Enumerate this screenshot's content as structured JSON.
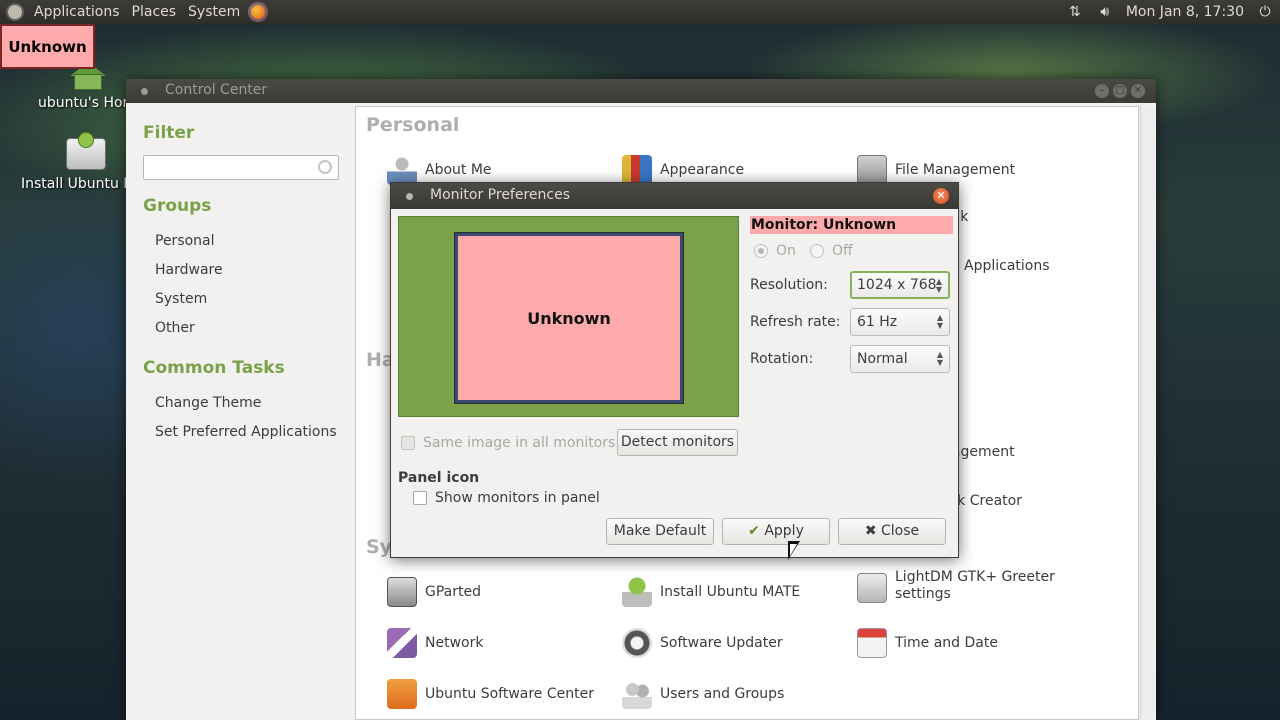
{
  "top_panel": {
    "menus": [
      "Applications",
      "Places",
      "System"
    ],
    "clock": "Mon Jan 8, 17:30"
  },
  "highlight_label": "Unknown",
  "desktop": {
    "home_label": "ubuntu's Hom",
    "install_label": "Install Ubuntu M"
  },
  "control_center": {
    "title": "Control Center",
    "filter_heading": "Filter",
    "groups_heading": "Groups",
    "groups": [
      "Personal",
      "Hardware",
      "System",
      "Other"
    ],
    "tasks_heading": "Common Tasks",
    "tasks": [
      "Change Theme",
      "Set Preferred Applications"
    ],
    "section_personal": "Personal",
    "section_hardware_partial": "Ha",
    "section_system_partial": "Sy",
    "items": {
      "about_me": "About Me",
      "appearance": "Appearance",
      "file_management": "File Management",
      "peak_partial": "eak",
      "applications_partial": "Applications",
      "management_partial": "nagement",
      "disk_creator_partial": "isk Creator",
      "gparted": "GParted",
      "install_ubuntu_mate": "Install Ubuntu MATE",
      "lightdm": "LightDM GTK+ Greeter settings",
      "network": "Network",
      "software_updater": "Software Updater",
      "time_and_date": "Time and Date",
      "ubuntu_software_center": "Ubuntu Software Center",
      "users_and_groups": "Users and Groups"
    }
  },
  "monitor_prefs": {
    "title": "Monitor Preferences",
    "monitor_label": "Unknown",
    "monitor_name": "Monitor: Unknown",
    "on_label": "On",
    "off_label": "Off",
    "resolution_label": "Resolution:",
    "resolution_value": "1024 x 768",
    "refresh_label": "Refresh rate:",
    "refresh_value": "61 Hz",
    "rotation_label": "Rotation:",
    "rotation_value": "Normal",
    "same_image_label": "Same image in all monitors",
    "detect_label": "Detect monitors",
    "panel_icon_heading": "Panel icon",
    "show_monitors_label": "Show monitors in panel",
    "make_default_label": "Make Default",
    "apply_label": "Apply",
    "close_label": "Close"
  },
  "colors": {
    "highlight": "#ffaaaa",
    "monitor_bg": "#79a24a",
    "accent_green": "#79a24a"
  }
}
